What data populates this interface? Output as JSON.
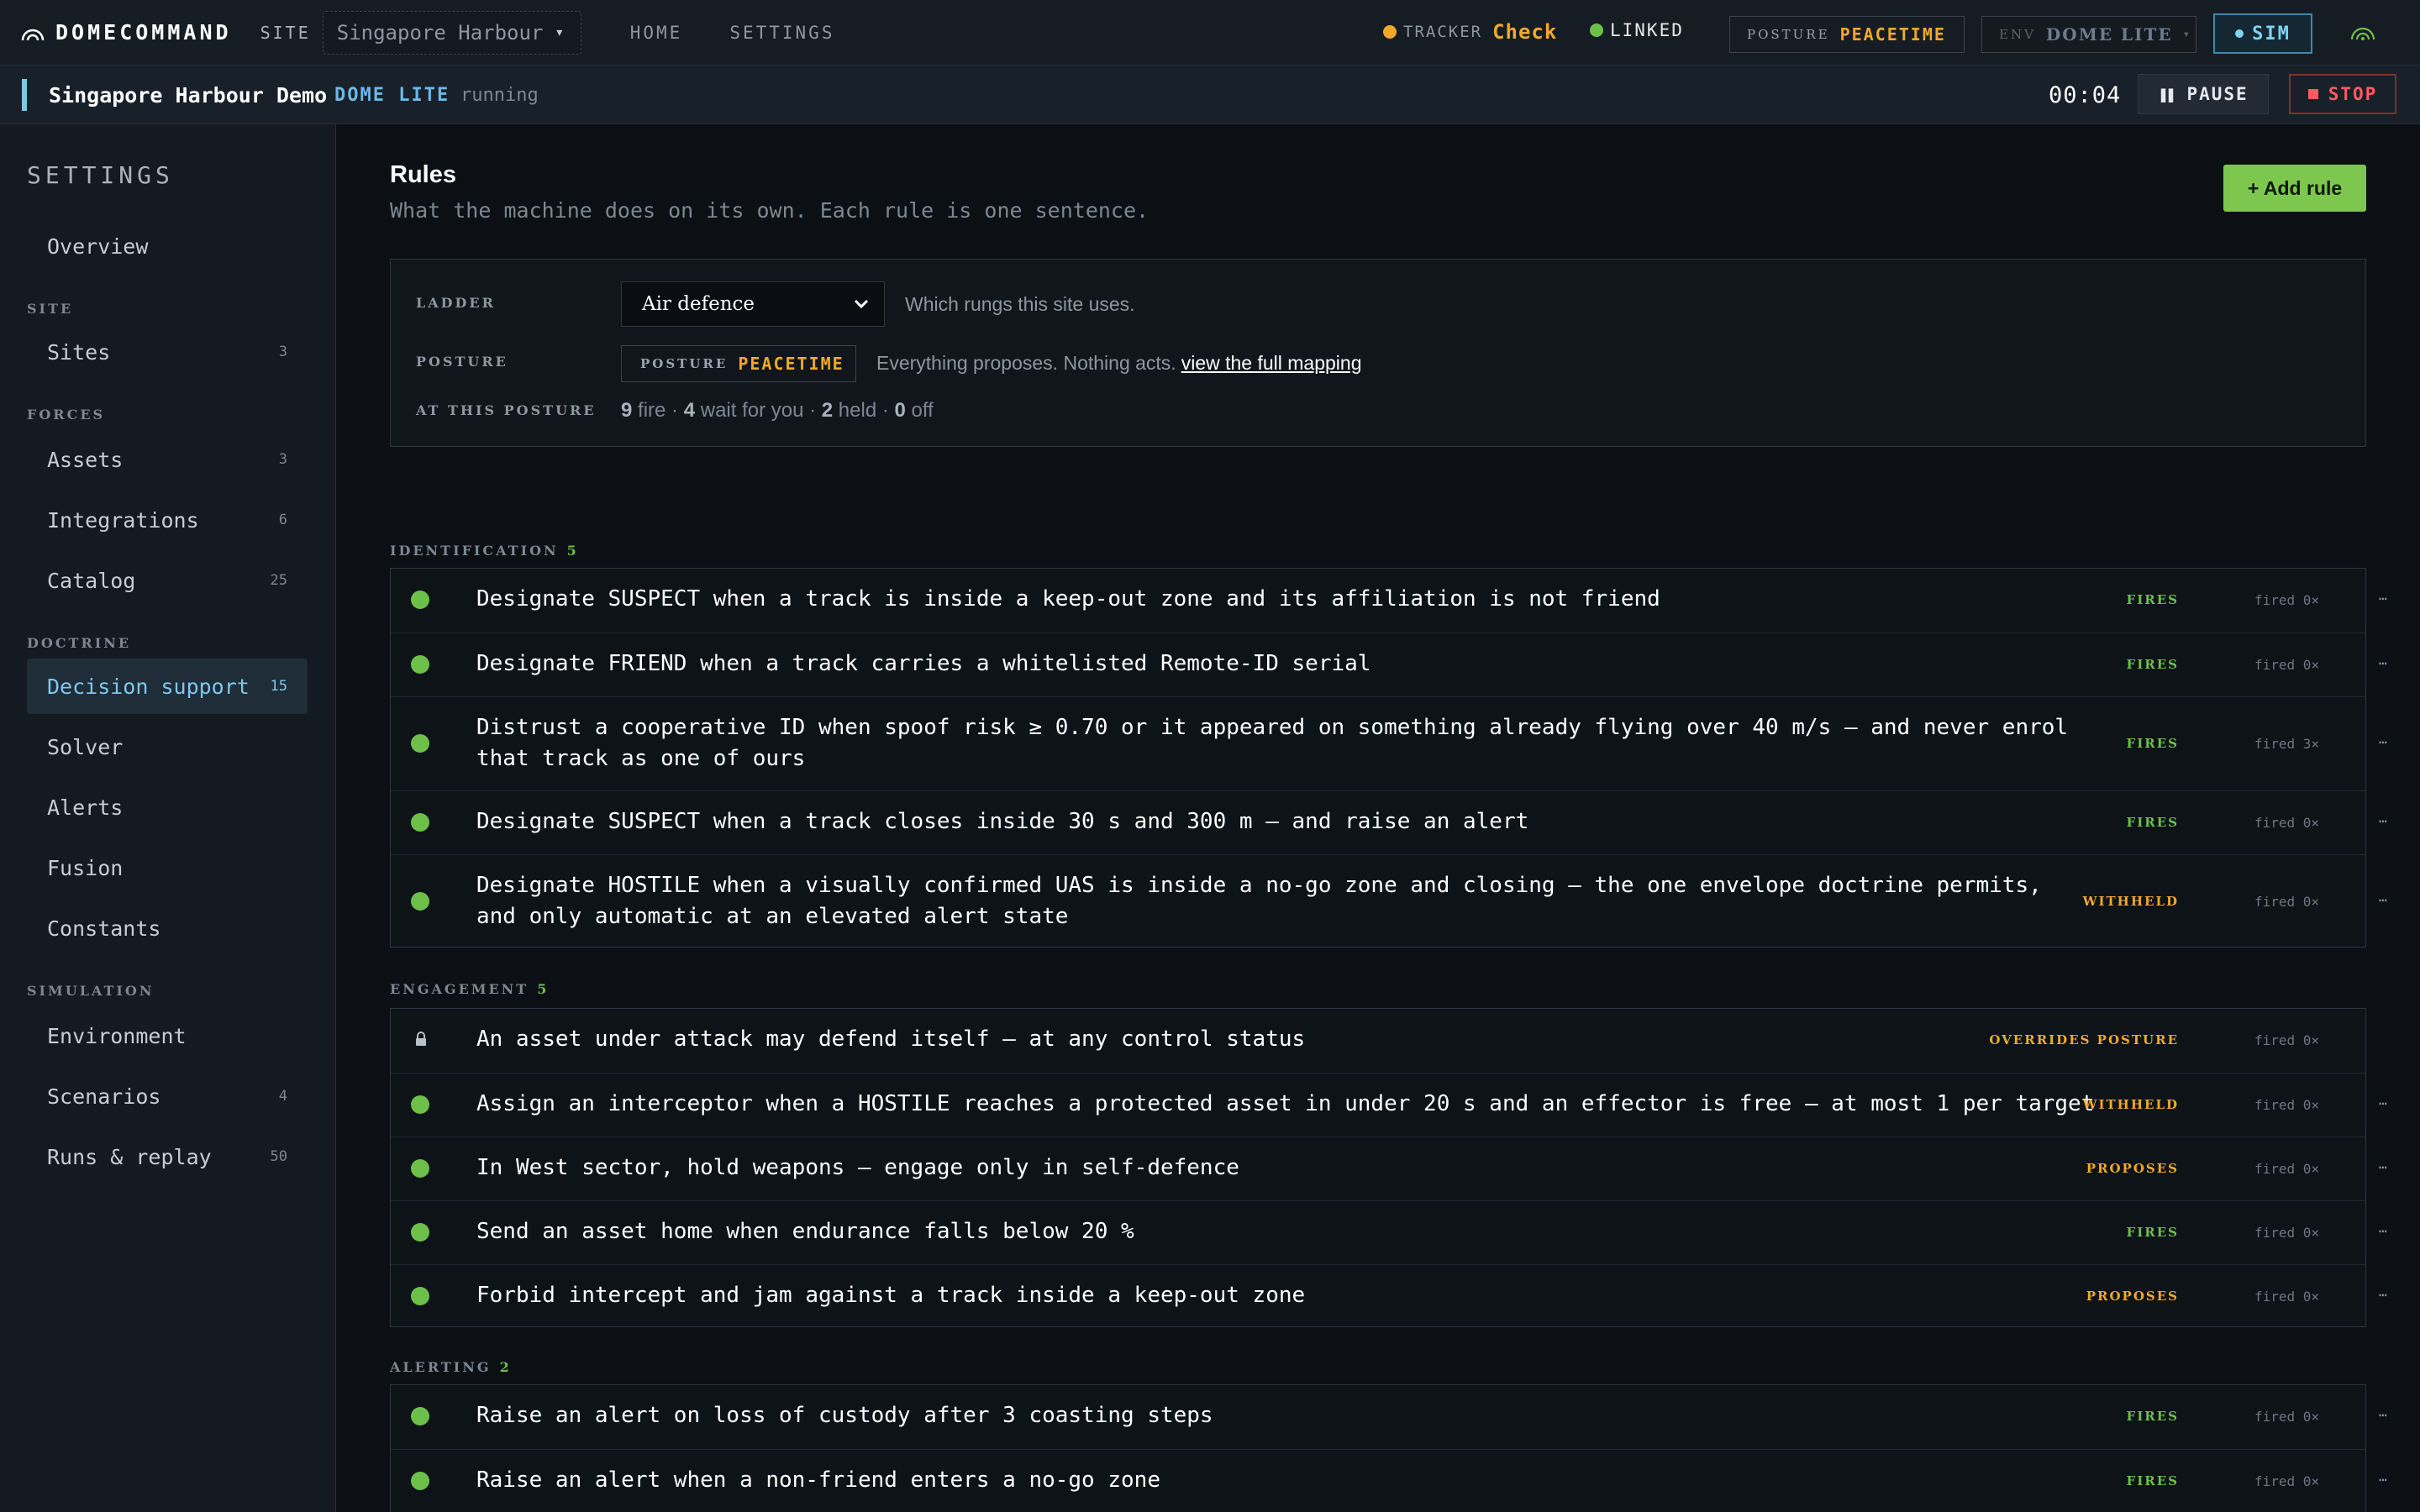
{
  "topbar": {
    "brand": "DOMECOMMAND",
    "site_label": "SITE",
    "site_value": "Singapore Harbour",
    "site_caret": "▾",
    "nav": [
      "HOME",
      "SETTINGS"
    ],
    "tracker_label": "TRACKER",
    "tracker_value": "Check",
    "linked_label": "LINKED",
    "posture_label": "POSTURE",
    "posture_value": "PEACETIME",
    "env_label": "ENV",
    "env_value": "DOME LITE",
    "env_caret": "▾",
    "sim_label": "SIM"
  },
  "runbar": {
    "name": "Singapore Harbour Demo",
    "env": "DOME LITE",
    "state": "running",
    "clock": "00:04",
    "pause_label": "PAUSE",
    "stop_label": "STOP"
  },
  "sidebar": {
    "title": "SETTINGS",
    "overview": "Overview",
    "groups": {
      "site": "SITE",
      "forces": "FORCES",
      "doctrine": "DOCTRINE",
      "simulation": "SIMULATION"
    },
    "items": [
      {
        "label": "Sites",
        "count": "3"
      },
      {
        "label": "Assets",
        "count": "3"
      },
      {
        "label": "Integrations",
        "count": "6"
      },
      {
        "label": "Catalog",
        "count": "25"
      },
      {
        "label": "Decision support",
        "count": "15"
      },
      {
        "label": "Solver",
        "count": ""
      },
      {
        "label": "Alerts",
        "count": ""
      },
      {
        "label": "Fusion",
        "count": ""
      },
      {
        "label": "Constants",
        "count": ""
      },
      {
        "label": "Environment",
        "count": ""
      },
      {
        "label": "Scenarios",
        "count": "4"
      },
      {
        "label": "Runs & replay",
        "count": "50"
      }
    ]
  },
  "main": {
    "title": "Rules",
    "subtitle": "What the machine does on its own. Each rule is one sentence.",
    "add_rule": "+ Add rule",
    "config": {
      "ladder_label": "LADDER",
      "ladder_value": "Air defence",
      "ladder_help": "Which rungs this site uses.",
      "posture_label": "POSTURE",
      "posture_chip_label": "POSTURE",
      "posture_chip_value": "PEACETIME",
      "posture_help": "Everything proposes. Nothing acts.",
      "posture_link": "view the full mapping",
      "at_posture_label": "AT THIS POSTURE",
      "counts": {
        "fire_n": "9",
        "fire_t": " fire · ",
        "wait_n": "4",
        "wait_t": " wait for you · ",
        "held_n": "2",
        "held_t": " held · ",
        "off_n": "0",
        "off_t": " off"
      }
    },
    "groups": [
      {
        "name": "IDENTIFICATION",
        "count": "5",
        "rules": [
          {
            "text": "Designate SUSPECT when a track is inside a keep-out zone and its affiliation is not friend",
            "tag": "FIRES",
            "fired": "fired 0×"
          },
          {
            "text": "Designate FRIEND when a track carries a whitelisted Remote-ID serial",
            "tag": "FIRES",
            "fired": "fired 0×"
          },
          {
            "text": "Distrust a cooperative ID when spoof risk ≥ 0.70 or it appeared on something already flying over 40 m/s — and never enrol that track as one of ours",
            "tag": "FIRES",
            "fired": "fired 3×"
          },
          {
            "text": "Designate SUSPECT when a track closes inside 30 s and 300 m — and raise an alert",
            "tag": "FIRES",
            "fired": "fired 0×"
          },
          {
            "text": "Designate HOSTILE when a visually confirmed UAS is inside a no-go zone and closing — the one envelope doctrine permits, and only automatic at an elevated alert state",
            "tag": "WITHHELD",
            "fired": "fired 0×"
          }
        ]
      },
      {
        "name": "ENGAGEMENT",
        "count": "5",
        "rules": [
          {
            "text": "An asset under attack may defend itself — at any control status",
            "tag": "OVERRIDES POSTURE",
            "fired": "fired 0×"
          },
          {
            "text": "Assign an interceptor when a HOSTILE reaches a protected asset in under 20 s and an effector is free — at most 1 per target",
            "tag": "WITHHELD",
            "fired": "fired 0×"
          },
          {
            "text": "In West sector, hold weapons — engage only in self-defence",
            "tag": "PROPOSES",
            "fired": "fired 0×"
          },
          {
            "text": "Send an asset home when endurance falls below 20 %",
            "tag": "FIRES",
            "fired": "fired 0×"
          },
          {
            "text": "Forbid intercept and jam against a track inside a keep-out zone",
            "tag": "PROPOSES",
            "fired": "fired 0×"
          }
        ]
      },
      {
        "name": "ALERTING",
        "count": "2",
        "rules": [
          {
            "text": "Raise an alert on loss of custody after 3 coasting steps",
            "tag": "FIRES",
            "fired": "fired 0×"
          },
          {
            "text": "Raise an alert when a non-friend enters a no-go zone",
            "tag": "FIRES",
            "fired": "fired 0×"
          }
        ]
      }
    ],
    "more_glyph": "⋯",
    "colors": {
      "fires": "#6cc04a",
      "amber": "#f0a92a",
      "accent": "#7fc6ea",
      "stop": "#ff5a5f"
    }
  }
}
